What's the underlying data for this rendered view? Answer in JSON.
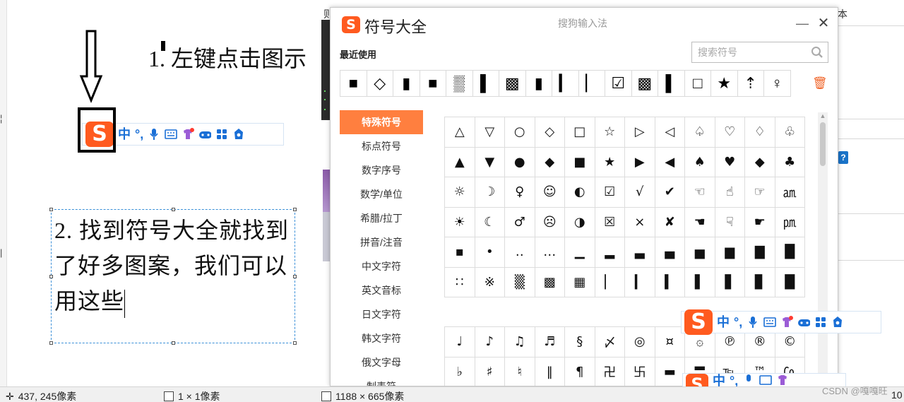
{
  "annotations": {
    "step1": "1. 左键点击图示",
    "step2": "2. 找到符号大全就找到了好多图案，我们可以用这些"
  },
  "background": {
    "strip_top_char": "本",
    "under_window_char": "则",
    "help_badge": "?"
  },
  "sogou_toolbar": {
    "logo": "S",
    "mode": "中",
    "punct": "°,",
    "icons": [
      "microphone-icon",
      "keyboard-icon",
      "skin-icon",
      "game-icon",
      "toolbox-icon",
      "settings-icon"
    ]
  },
  "symbol_window": {
    "logo": "S",
    "title": "符号大全",
    "subtitle": "搜狗输入法",
    "minimize": "—",
    "close": "✕",
    "recent_label": "最近使用",
    "search_placeholder": "搜索符号",
    "recent": [
      "■",
      "◇",
      "▮",
      "■",
      "▒",
      "▌",
      "▩",
      "▮",
      "▎",
      "▏",
      "☑",
      "▩",
      "▌",
      "□",
      "★",
      "⇡",
      "♀"
    ],
    "categories": [
      "特殊符号",
      "标点符号",
      "数字序号",
      "数学/单位",
      "希腊/拉丁",
      "拼音/注音",
      "中文字符",
      "英文音标",
      "日文字符",
      "韩文字符",
      "俄文字母",
      "制表符"
    ],
    "active_category": "特殊符号",
    "grid_top": [
      "△",
      "▽",
      "○",
      "◇",
      "□",
      "☆",
      "▷",
      "◁",
      "♤",
      "♡",
      "♢",
      "♧",
      "▲",
      "▼",
      "●",
      "◆",
      "■",
      "★",
      "▶",
      "◀",
      "♠",
      "♥",
      "◆",
      "♣",
      "☼",
      "☽",
      "♀",
      "☺",
      "◐",
      "☑",
      "√",
      "✔",
      "☜",
      "☝",
      "☞",
      "㏂",
      "☀",
      "☾",
      "♂",
      "☹",
      "◑",
      "☒",
      "×",
      "✘",
      "☚",
      "☟",
      "☛",
      "㏘",
      "▪",
      "•",
      "‥",
      "…",
      "▁",
      "▂",
      "▃",
      "▄",
      "▅",
      "▆",
      "▇",
      "█",
      "∷",
      "※",
      "▒",
      "▩",
      "▦",
      "▏",
      "▎",
      "▍",
      "▌",
      "▋",
      "▊",
      "█"
    ],
    "grid_bottom": [
      "♩",
      "♪",
      "♫",
      "♬",
      "§",
      "〆",
      "◎",
      "¤",
      "۞",
      "℗",
      "®",
      "©",
      "♭",
      "♯",
      "♮",
      "‖",
      "¶",
      "卍",
      "卐",
      "▬",
      "〓",
      "℡",
      "™",
      "㏇"
    ]
  },
  "status_bar": {
    "cursor_pos": "437, 245像素",
    "selection": "1 × 1像素",
    "image_size": "1188 × 665像素",
    "zoom_partial": "10"
  },
  "watermark": "CSDN @嘎嘎旺",
  "colors": {
    "sogou_orange": "#ff5a1f",
    "active_category": "#ff7f3f",
    "toolbar_blue": "#1a6fd6"
  }
}
